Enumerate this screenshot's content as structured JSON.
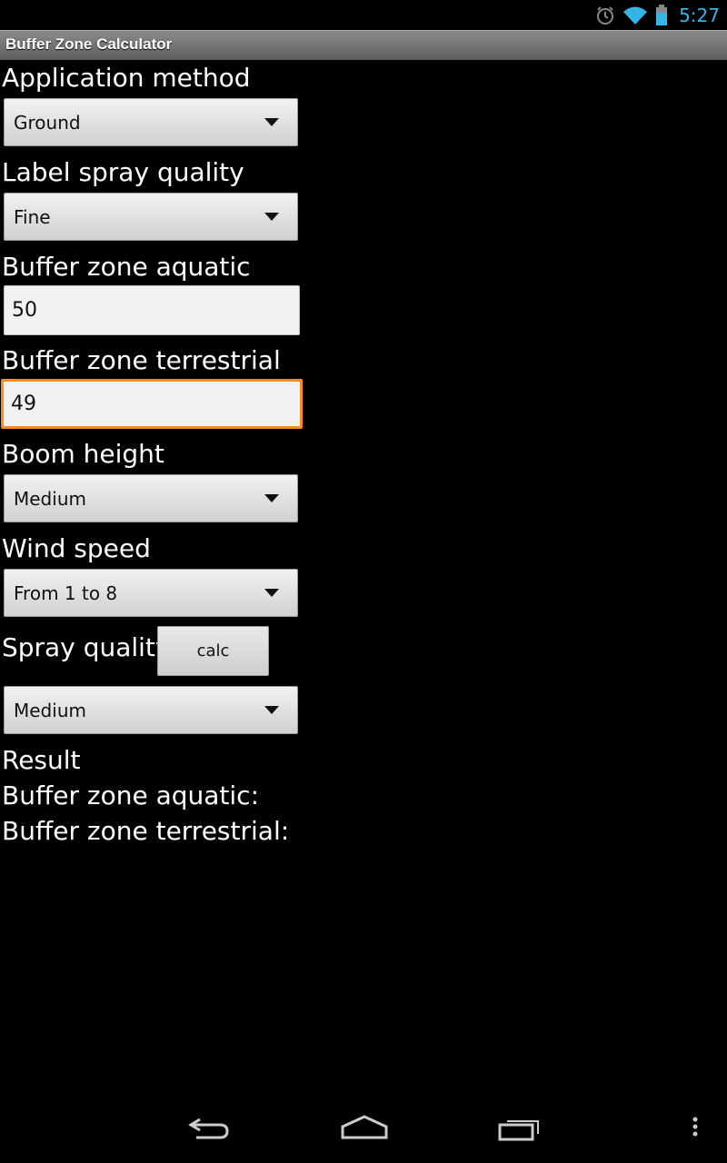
{
  "status_bar": {
    "time": "5:27"
  },
  "app": {
    "title": "Buffer Zone Calculator"
  },
  "form": {
    "application_method": {
      "label": "Application method",
      "value": "Ground"
    },
    "label_spray_quality": {
      "label": "Label spray quality",
      "value": "Fine"
    },
    "buffer_zone_aquatic": {
      "label": "Buffer zone aquatic",
      "value": "50"
    },
    "buffer_zone_terrestrial": {
      "label": "Buffer zone terrestrial",
      "value": "49"
    },
    "boom_height": {
      "label": "Boom height",
      "value": "Medium"
    },
    "wind_speed": {
      "label": "Wind speed",
      "value": "From 1 to 8"
    },
    "spray_quality": {
      "label": "Spray quality",
      "value": "Medium"
    },
    "calc_button": "calc"
  },
  "result": {
    "heading": "Result",
    "aquatic_label": "Buffer zone aquatic:",
    "terrestrial_label": "Buffer zone terrestrial:"
  },
  "colors": {
    "accent": "#33b5e5",
    "focus": "#ff8c1a"
  }
}
